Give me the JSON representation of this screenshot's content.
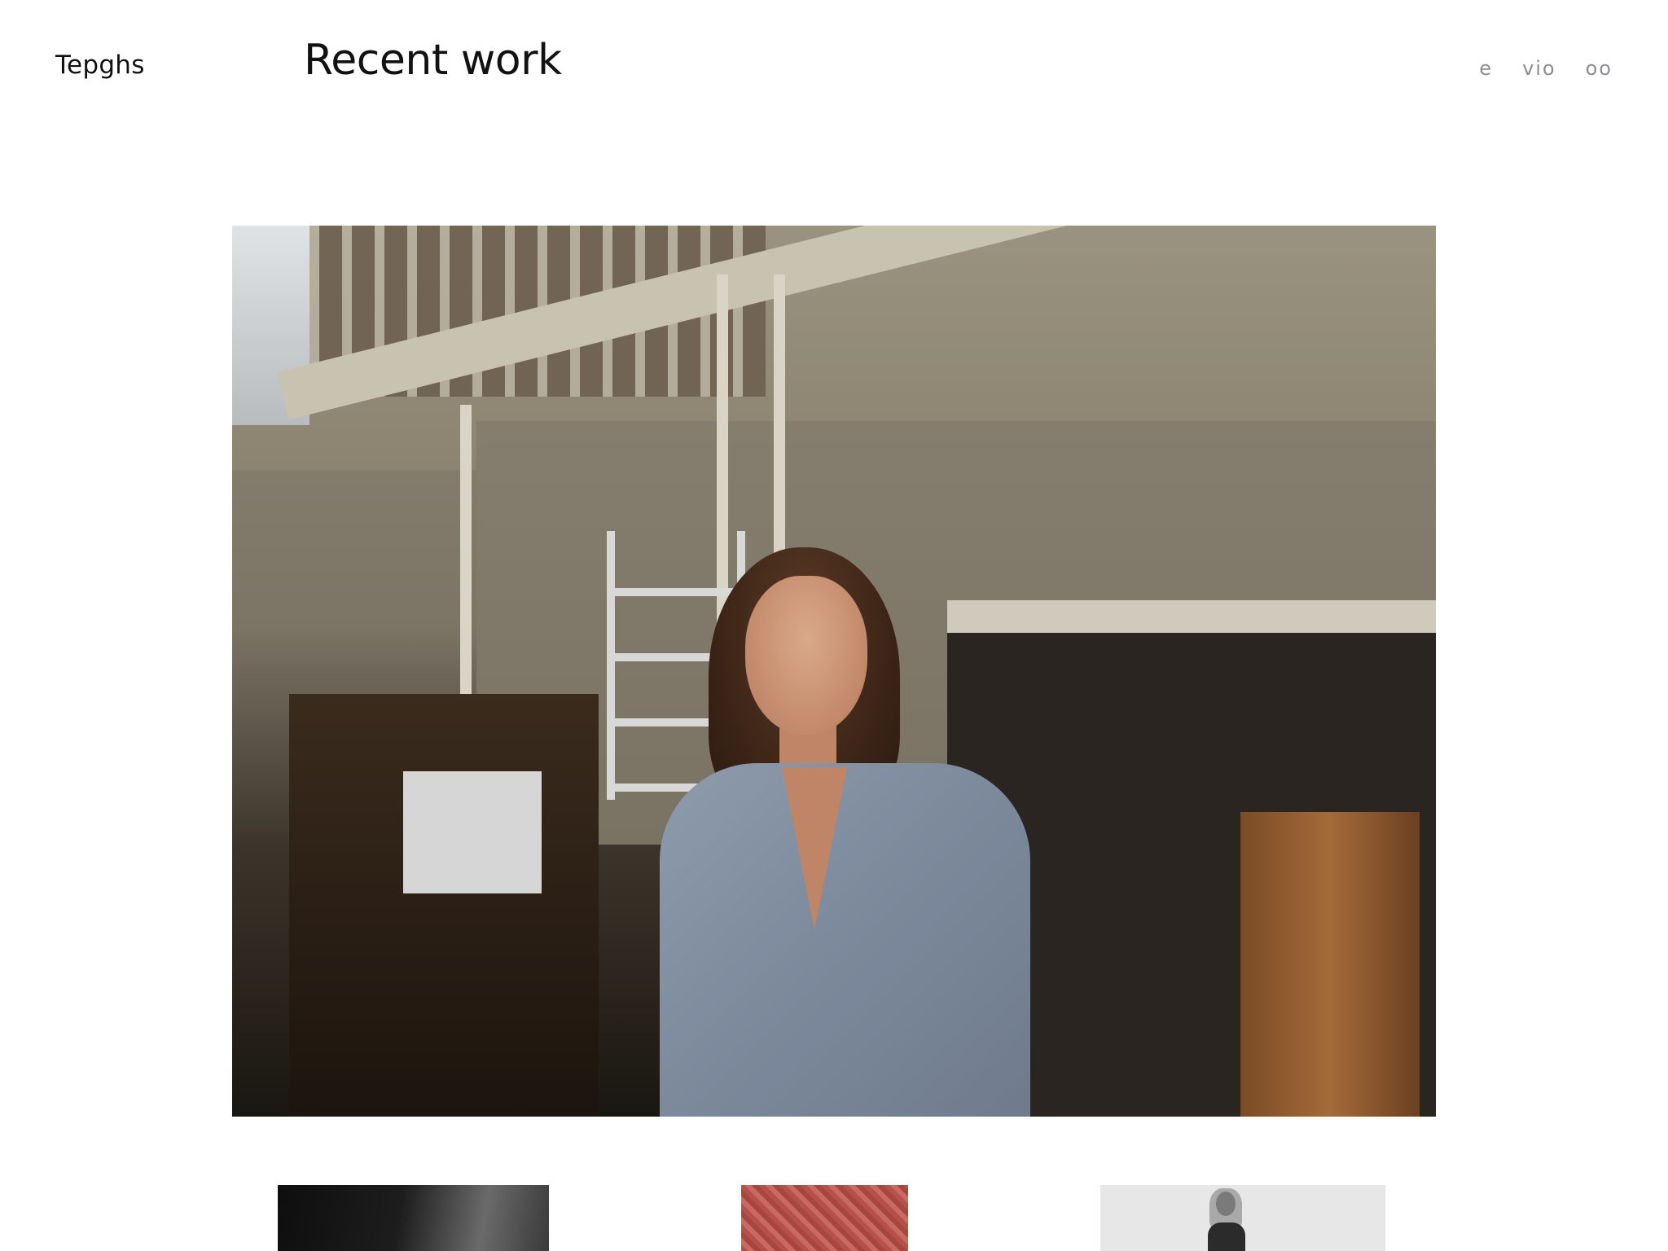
{
  "header": {
    "brand": "Tepghs",
    "title": "Recent work",
    "nav": [
      {
        "label": "e"
      },
      {
        "label": "vio"
      },
      {
        "label": "oo"
      }
    ]
  },
  "hero": {
    "subject": "portrait of a woman in a blue short-sleeve shirt in a warehouse studio"
  },
  "thumbnails": [
    {
      "subject": "dark gradient photograph"
    },
    {
      "subject": "red textured fabric"
    },
    {
      "subject": "black and white portrait"
    }
  ],
  "colors": {
    "background": "#ffffff",
    "text": "#111111",
    "nav": "#8a8f94"
  }
}
